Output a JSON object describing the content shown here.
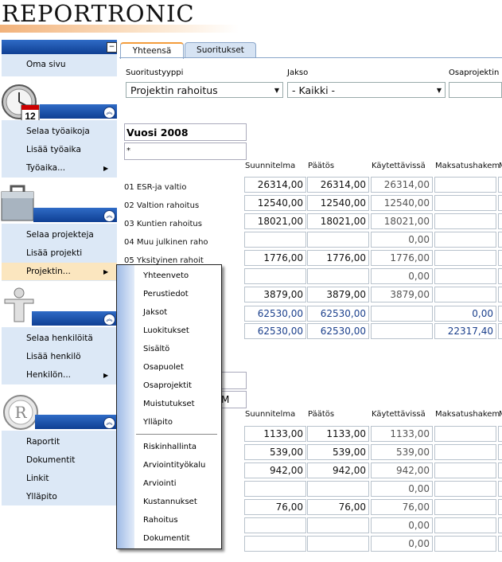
{
  "app": {
    "logo": "REPORTRONIC"
  },
  "sidebar": {
    "home": {
      "label": "Oma sivu"
    },
    "worktime": {
      "icon_date": "12",
      "items": [
        {
          "label": "Selaa työaikoja"
        },
        {
          "label": "Lisää työaika"
        },
        {
          "label": "Työaika..."
        }
      ]
    },
    "projects": {
      "items": [
        {
          "label": "Selaa projekteja"
        },
        {
          "label": "Lisää projekti"
        },
        {
          "label": "Projektin..."
        }
      ]
    },
    "people": {
      "items": [
        {
          "label": "Selaa henkilöitä"
        },
        {
          "label": "Lisää henkilö"
        },
        {
          "label": "Henkilön..."
        }
      ]
    },
    "reports": {
      "items": [
        {
          "label": "Raportit"
        },
        {
          "label": "Dokumentit"
        },
        {
          "label": "Linkit"
        },
        {
          "label": "Ylläpito"
        }
      ]
    }
  },
  "tabs": [
    {
      "label": "Yhteensä"
    },
    {
      "label": "Suoritukset"
    }
  ],
  "filters": {
    "type_label": "Suoritustyyppi",
    "type_value": "Projektin rahoitus",
    "period_label": "Jakso",
    "period_value": "- Kaikki -",
    "subproject_label": "Osaprojektin ko"
  },
  "year": {
    "title": "Vuosi 2008",
    "star": "*"
  },
  "columns": [
    "Suunnitelma",
    "Päätös",
    "Käytettävissä",
    "Maksatushakem",
    "M"
  ],
  "section1": {
    "rows": [
      {
        "label": "01 ESR-ja valtio",
        "values": [
          "26314,00",
          "26314,00",
          "26314,00",
          ""
        ]
      },
      {
        "label": "02 Valtion rahoitus",
        "values": [
          "12540,00",
          "12540,00",
          "12540,00",
          ""
        ]
      },
      {
        "label": "03 Kuntien rahoitus",
        "values": [
          "18021,00",
          "18021,00",
          "18021,00",
          ""
        ]
      },
      {
        "label": "04 Muu julkinen raho",
        "values": [
          "",
          "",
          "0,00",
          ""
        ]
      },
      {
        "label": "05 Yksityinen rahoit",
        "values": [
          "1776,00",
          "1776,00",
          "1776,00",
          ""
        ]
      },
      {
        "label": "",
        "values": [
          "",
          "",
          "0,00",
          ""
        ]
      },
      {
        "label": "",
        "values": [
          "3879,00",
          "3879,00",
          "3879,00",
          ""
        ]
      }
    ],
    "totals": [
      {
        "values": [
          "62530,00",
          "62530,00",
          "",
          "0,00"
        ]
      },
      {
        "values": [
          "62530,00",
          "62530,00",
          "",
          "22317,40"
        ]
      }
    ]
  },
  "section2": {
    "header_input2": "M",
    "rows": [
      {
        "values": [
          "1133,00",
          "1133,00",
          "1133,00",
          ""
        ]
      },
      {
        "values": [
          "539,00",
          "539,00",
          "539,00",
          ""
        ]
      },
      {
        "values": [
          "942,00",
          "942,00",
          "942,00",
          ""
        ]
      },
      {
        "values": [
          "",
          "",
          "0,00",
          ""
        ]
      },
      {
        "values": [
          "76,00",
          "76,00",
          "76,00",
          ""
        ]
      },
      {
        "values": [
          "",
          "",
          "0,00",
          ""
        ]
      },
      {
        "values": [
          "",
          "",
          "0,00",
          ""
        ]
      }
    ]
  },
  "context_menu": {
    "items": [
      "Yhteenveto",
      "Perustiedot",
      "Jaksot",
      "Luokitukset",
      "Sisältö",
      "Osapuolet",
      "Osaprojektit",
      "Muistutukset",
      "Ylläpito"
    ],
    "items2": [
      "Riskinhallinta",
      "Arviointityökalu",
      "Arviointi",
      "Kustannukset",
      "Rahoitus",
      "Dokumentit"
    ]
  },
  "colors": {
    "sidebar_header": "#1a4ea8",
    "sidebar_body": "#dce8f6",
    "highlight": "#fbe6bf",
    "tab_accent": "#f39c3c"
  }
}
